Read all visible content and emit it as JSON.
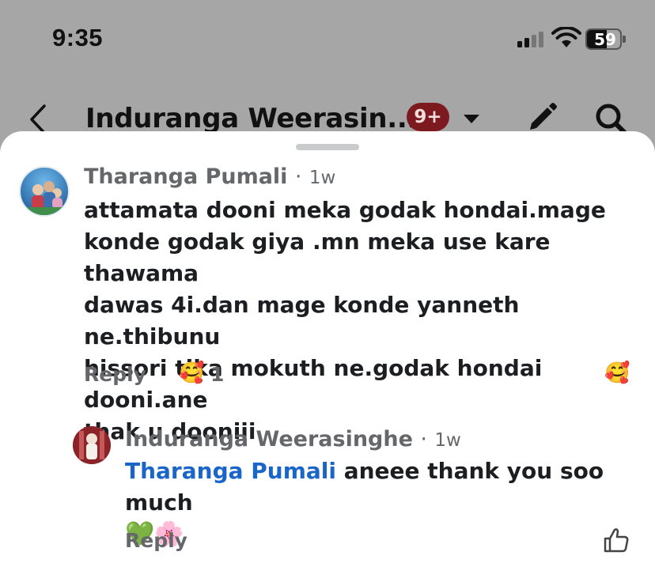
{
  "status_bar": {
    "time": "9:35",
    "battery": "59",
    "battery_level": 0.59
  },
  "nav": {
    "title": "Induranga Weerasin...",
    "badge": "9+",
    "icons": [
      "back-arrow-icon",
      "dropdown-caret-icon",
      "pencil-icon",
      "search-icon"
    ]
  },
  "comments": [
    {
      "author": "Tharanga Pumali",
      "separator": "·",
      "time": "1w",
      "text_lines": [
        "attamata dooni meka godak hondai.mage",
        "konde godak giya .mn meka use kare thawama",
        "dawas 4i.dan mage konde yanneth ne.thibunu",
        "hissori tika mokuth ne.godak hondai dooni.ane",
        "thak u dooniii"
      ],
      "reply_label": "Reply",
      "reaction_emoji": "🥰",
      "reaction_count": "1",
      "care_emoji": "🥰"
    }
  ],
  "reply": {
    "author": "Induranga Weerasinghe",
    "separator": "·",
    "time": "1w",
    "mention": "Tharanga Pumali",
    "text": " aneee thank you soo much",
    "emojis": "💚🌸",
    "reply_label": "Reply",
    "like_icon": "thumbs-up-icon"
  },
  "colors": {
    "overlay": "#a6a6a6",
    "badge": "#7d1a1f",
    "mention": "#1a66c8",
    "meta_gray": "#65676b"
  }
}
